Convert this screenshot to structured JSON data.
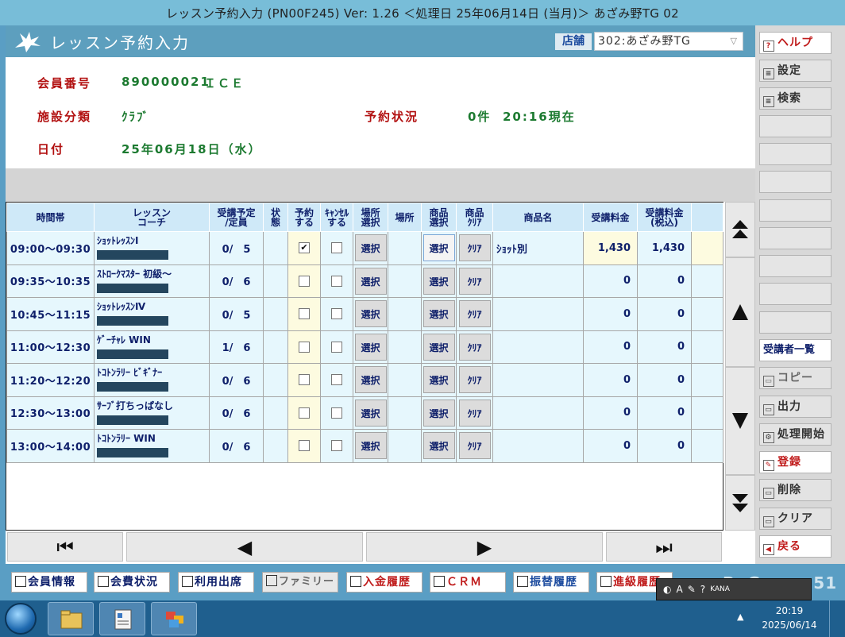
{
  "window": {
    "title": "レッスン予約入力 (PN00F245) Ver: 1.26 ＜処理日 25年06月14日 (当月)＞ あざみ野TG 02"
  },
  "header": {
    "title": "レッスン予約入力",
    "store_label": "店舗",
    "store_value": "302:あざみ野TG"
  },
  "member": {
    "label": "会員番号",
    "number": "890000021",
    "name": "ＩＣＥ"
  },
  "facility": {
    "label": "施設分類",
    "value": "ｸﾗﾌﾞ"
  },
  "reservation": {
    "label": "予約状況",
    "count": "0件",
    "time": "20:16現在"
  },
  "date": {
    "label": "日付",
    "value": "25年06月18日（水）"
  },
  "columns": [
    "時間帯",
    "レッスン\nコーチ",
    "受講予定\n/定員",
    "状\n態",
    "予約\nする",
    "ｷｬﾝｾﾙ\nする",
    "場所\n選択",
    "場所",
    "商品\n選択",
    "商品\nｸﾘｱ",
    "商品名",
    "受講料金",
    "受講料金\n(税込)",
    ""
  ],
  "rows": [
    {
      "time": "09:00～09:30",
      "lesson": "ｼｮｯﾄﾚｯｽﾝⅠ",
      "cap": "0/　5",
      "reserve": true,
      "cancel": false,
      "place_btn": "選択",
      "prod_btn": "選択",
      "clear_btn": "ｸﾘｱ",
      "product": "ｼｮｯﾄ別",
      "fee": "1,430",
      "fee_tax": "1,430"
    },
    {
      "time": "09:35～10:35",
      "lesson": "ｽﾄﾛｰｸﾏｽﾀｰ 初級～",
      "cap": "0/　6",
      "reserve": false,
      "cancel": false,
      "place_btn": "選択",
      "prod_btn": "選択",
      "clear_btn": "ｸﾘｱ",
      "product": "",
      "fee": "0",
      "fee_tax": "0"
    },
    {
      "time": "10:45～11:15",
      "lesson": "ｼｮｯﾄﾚｯｽﾝⅣ",
      "cap": "0/　5",
      "reserve": false,
      "cancel": false,
      "place_btn": "選択",
      "prod_btn": "選択",
      "clear_btn": "ｸﾘｱ",
      "product": "",
      "fee": "0",
      "fee_tax": "0"
    },
    {
      "time": "11:00～12:30",
      "lesson": "ｹﾞｰﾁｬﾚ WIN",
      "cap": "1/　6",
      "reserve": false,
      "cancel": false,
      "place_btn": "選択",
      "prod_btn": "選択",
      "clear_btn": "ｸﾘｱ",
      "product": "",
      "fee": "0",
      "fee_tax": "0"
    },
    {
      "time": "11:20～12:20",
      "lesson": "ﾄｺﾄﾝﾗﾘｰ ﾋﾞｷﾞﾅｰ",
      "cap": "0/　6",
      "reserve": false,
      "cancel": false,
      "place_btn": "選択",
      "prod_btn": "選択",
      "clear_btn": "ｸﾘｱ",
      "product": "",
      "fee": "0",
      "fee_tax": "0"
    },
    {
      "time": "12:30～13:00",
      "lesson": "ｻｰﾌﾞ打ちっぱなし",
      "cap": "0/　6",
      "reserve": false,
      "cancel": false,
      "place_btn": "選択",
      "prod_btn": "選択",
      "clear_btn": "ｸﾘｱ",
      "product": "",
      "fee": "0",
      "fee_tax": "0"
    },
    {
      "time": "13:00～14:00",
      "lesson": "ﾄｺﾄﾝﾗﾘｰ WIN",
      "cap": "0/　6",
      "reserve": false,
      "cancel": false,
      "place_btn": "選択",
      "prod_btn": "選択",
      "clear_btn": "ｸﾘｱ",
      "product": "",
      "fee": "0",
      "fee_tax": "0"
    }
  ],
  "right_buttons": {
    "help": "ヘルプ",
    "settings": "設定",
    "search": "検索",
    "attendees": "受講者一覧",
    "copy": "コピー",
    "output": "出力",
    "process": "処理開始",
    "register": "登録",
    "delete": "削除",
    "clear": "クリア",
    "back": "戻る"
  },
  "bottom_buttons": {
    "member_info": "会員情報",
    "fee_status": "会費状況",
    "usage": "利用出席",
    "family": "ファミリー",
    "payment": "入金履歴",
    "crm": "ＣＲＭ",
    "transfer": "振替履歴",
    "promotion": "進級履歴"
  },
  "brand": "ReGenus 51",
  "ime": {
    "mode": "KANA"
  },
  "taskbar": {
    "time": "20:19",
    "date": "2025/06/14"
  },
  "icons": {
    "nav_first": "⏮",
    "nav_prev": "◀",
    "nav_next": "▶",
    "nav_last": "⏭"
  }
}
